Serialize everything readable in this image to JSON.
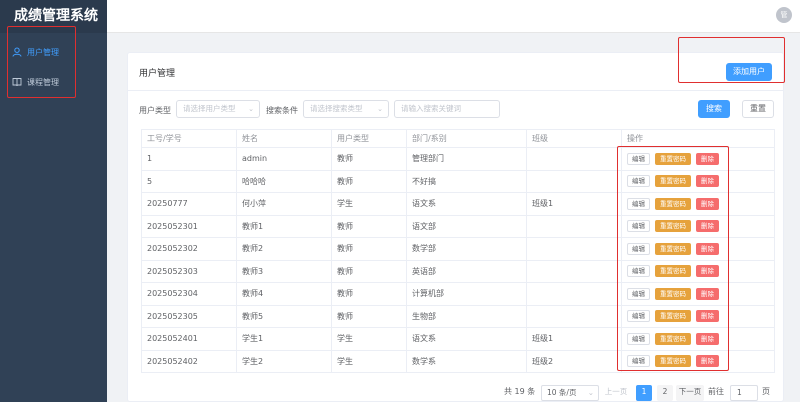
{
  "app": {
    "title": "成绩管理系统",
    "avatar_text": "管"
  },
  "sidebar": {
    "items": [
      {
        "label": "用户管理",
        "icon": "user-icon",
        "active": true
      },
      {
        "label": "课程管理",
        "icon": "book-icon",
        "active": false
      }
    ]
  },
  "card": {
    "title": "用户管理",
    "add_button": "添加用户"
  },
  "filters": {
    "user_type_label": "用户类型",
    "user_type_placeholder": "请选择用户类型",
    "search_cond_label": "搜索条件",
    "search_cond_placeholder": "请选择搜索类型",
    "keyword_placeholder": "请输入搜索关键词",
    "search_button": "搜索",
    "reset_button": "重置"
  },
  "table": {
    "columns": [
      "工号/学号",
      "姓名",
      "用户类型",
      "部门/系别",
      "班级",
      "操作"
    ],
    "actions": {
      "edit": "编辑",
      "reset": "重置密码",
      "delete": "删除"
    },
    "rows": [
      [
        "1",
        "admin",
        "教师",
        "管理部门",
        ""
      ],
      [
        "5",
        "哈哈哈",
        "教师",
        "不好搞",
        ""
      ],
      [
        "20250777",
        "何小萍",
        "学生",
        "语文系",
        "班级1"
      ],
      [
        "2025052301",
        "教师1",
        "教师",
        "语文部",
        ""
      ],
      [
        "2025052302",
        "教师2",
        "教师",
        "数学部",
        ""
      ],
      [
        "2025052303",
        "教师3",
        "教师",
        "英语部",
        ""
      ],
      [
        "2025052304",
        "教师4",
        "教师",
        "计算机部",
        ""
      ],
      [
        "2025052305",
        "教师5",
        "教师",
        "生物部",
        ""
      ],
      [
        "2025052401",
        "学生1",
        "学生",
        "语文系",
        "班级1"
      ],
      [
        "2025052402",
        "学生2",
        "学生",
        "数学系",
        "班级2"
      ]
    ]
  },
  "pagination": {
    "total": "共 19 条",
    "page_size": "10 条/页",
    "prev": "上一页",
    "pages": [
      "1",
      "2"
    ],
    "current": "1",
    "next": "下一页",
    "goto_label": "前往",
    "goto_value": "1",
    "page_unit": "页"
  },
  "colors": {
    "primary": "#409eff",
    "warning": "#e6a23c",
    "danger": "#f56c6c",
    "sidebar": "#304156",
    "annotation": "#e02f2f"
  }
}
